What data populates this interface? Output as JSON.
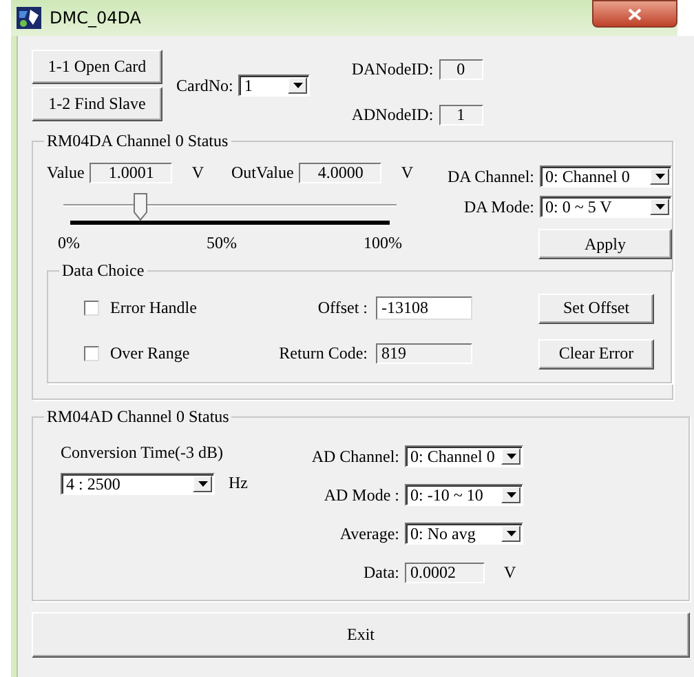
{
  "window": {
    "title": "DMC_04DA"
  },
  "card_buttons": [
    "1-1 Open Card",
    "1-2 Find Slave"
  ],
  "card_no": {
    "label": "CardNo:",
    "value": "1"
  },
  "node_ids": [
    {
      "label": "DANodeID:",
      "value": "0"
    },
    {
      "label": "ADNodeID:",
      "value": "1"
    }
  ],
  "da_group": {
    "title": "RM04DA Channel 0 Status",
    "readouts": [
      {
        "label": "Value",
        "value": "1.0001",
        "unit": "V"
      },
      {
        "label": "OutValue",
        "value": "4.0000",
        "unit": "V"
      }
    ],
    "slider": {
      "level": 0.22
    },
    "scale_labels": [
      "0%",
      "50%",
      "100%"
    ],
    "combos": [
      {
        "label": "DA Channel:",
        "value": "0: Channel 0"
      },
      {
        "label": "DA Mode:",
        "value": "0: 0 ~ 5 V"
      }
    ],
    "apply_button": "Apply",
    "data_choice": {
      "title": "Data Choice",
      "rows": [
        {
          "checkbox": {
            "label": "Error Handle",
            "checked": false
          },
          "field": {
            "label": "Offset :",
            "value": "-13108",
            "editable": true
          },
          "button": "Set Offset"
        },
        {
          "checkbox": {
            "label": "Over Range",
            "checked": false
          },
          "field": {
            "label": "Return Code:",
            "value": "819",
            "editable": false
          },
          "button": "Clear Error"
        }
      ]
    }
  },
  "ad_group": {
    "title": "RM04AD Channel 0 Status",
    "conversion_time": {
      "label": "Conversion Time(-3 dB)",
      "value": "4 : 2500",
      "unit": "Hz"
    },
    "fields": [
      {
        "kind": "combo",
        "label": "AD Channel:",
        "value": "0: Channel 0"
      },
      {
        "kind": "combo",
        "label": "AD Mode :",
        "value": "0: -10 ~ 10"
      },
      {
        "kind": "combo",
        "label": "Average:",
        "value": "0: No avg"
      },
      {
        "kind": "readout",
        "label": "Data:",
        "value": "0.0002",
        "unit": "V"
      }
    ]
  },
  "exit_button": "Exit"
}
